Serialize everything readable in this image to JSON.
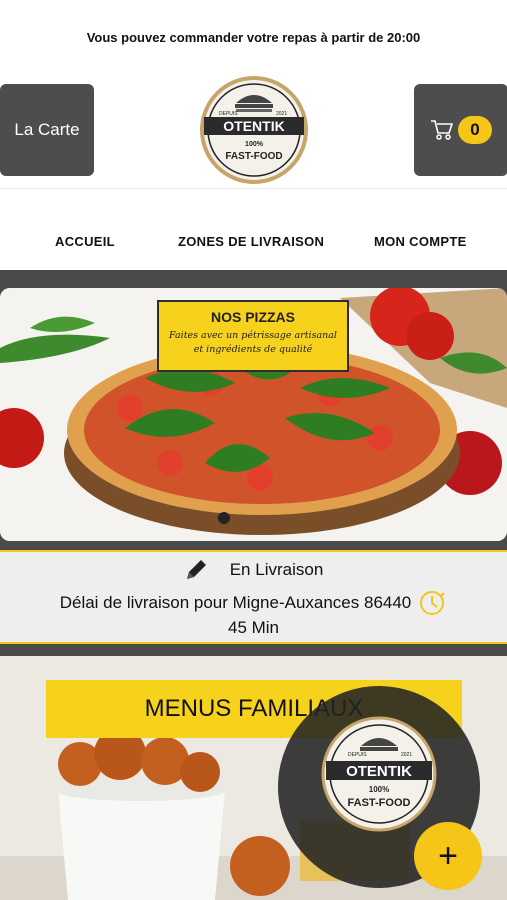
{
  "announcement": "Vous pouvez commander votre repas à partir de 20:00",
  "header": {
    "menu_button_label": "La Carte",
    "cart_count": "0",
    "cart_icon": "cart-icon"
  },
  "logo": {
    "since": "DEPUIS",
    "year": "2021",
    "brand": "OTENTIK",
    "pct": "100%",
    "tagline": "FAST-FOOD"
  },
  "nav": {
    "items": [
      {
        "label": "ACCUEIL"
      },
      {
        "label": "ZONES DE LIVRAISON"
      },
      {
        "label": "MON COMPTE"
      }
    ]
  },
  "hero": {
    "promo_title": "NOS PIZZAS",
    "promo_subtitle": "Faites avec un pétrissage artisanal et ingrédients de qualité"
  },
  "delivery": {
    "mode": "En Livraison",
    "delay_text": "Délai de livraison pour Migne-Auxances 86440",
    "duration": "45 Min",
    "edit_icon": "pencil-icon",
    "clock_icon": "clock-icon"
  },
  "menus": {
    "banner": "MENUS FAMILIAUX"
  },
  "fab": {
    "plus": "+"
  },
  "colors": {
    "accent": "#f5c518",
    "dark": "#4a4a4a"
  }
}
